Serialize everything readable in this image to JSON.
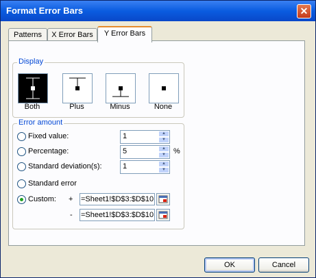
{
  "window": {
    "title": "Format Error Bars",
    "close_symbol": "✕"
  },
  "tabs": [
    {
      "label": "Patterns"
    },
    {
      "label": "X Error Bars"
    },
    {
      "label": "Y Error Bars",
      "active": true
    }
  ],
  "display": {
    "title": "Display",
    "options": [
      {
        "label": "Both",
        "icon": "error-bar-both-icon",
        "selected": true
      },
      {
        "label": "Plus",
        "icon": "error-bar-plus-icon"
      },
      {
        "label": "Minus",
        "icon": "error-bar-minus-icon"
      },
      {
        "label": "None",
        "icon": "error-bar-none-icon"
      }
    ]
  },
  "error_amount": {
    "title": "Error amount",
    "fixed_value": {
      "label": "Fixed value:",
      "value": "1"
    },
    "percentage": {
      "label": "Percentage:",
      "value": "5",
      "unit": "%"
    },
    "std_dev": {
      "label": "Standard deviation(s):",
      "value": "1"
    },
    "std_error": {
      "label": "Standard error"
    },
    "custom": {
      "label": "Custom:",
      "selected": true,
      "plus_sign": "+",
      "minus_sign": "-",
      "plus_ref": "=Sheet1!$D$3:$D$10",
      "minus_ref": "=Sheet1!$D$3:$D$10"
    }
  },
  "buttons": {
    "ok": "OK",
    "cancel": "Cancel"
  }
}
